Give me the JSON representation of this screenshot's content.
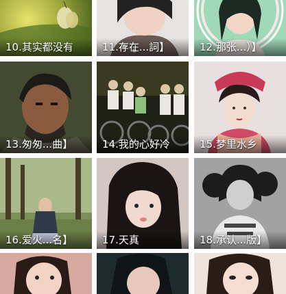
{
  "tiles": [
    {
      "caption": "10.其实都没有"
    },
    {
      "caption": "11.存在...詞】"
    },
    {
      "caption": "12.那张...）】"
    },
    {
      "caption": "13.匆匆...曲】"
    },
    {
      "caption": "14.我的心好冷"
    },
    {
      "caption": "15.梦里水乡"
    },
    {
      "caption": "16.爱火...名】"
    },
    {
      "caption": "17.天真"
    },
    {
      "caption": "18.承认...版】"
    },
    {
      "caption": ""
    },
    {
      "caption": ""
    },
    {
      "caption": ""
    }
  ]
}
